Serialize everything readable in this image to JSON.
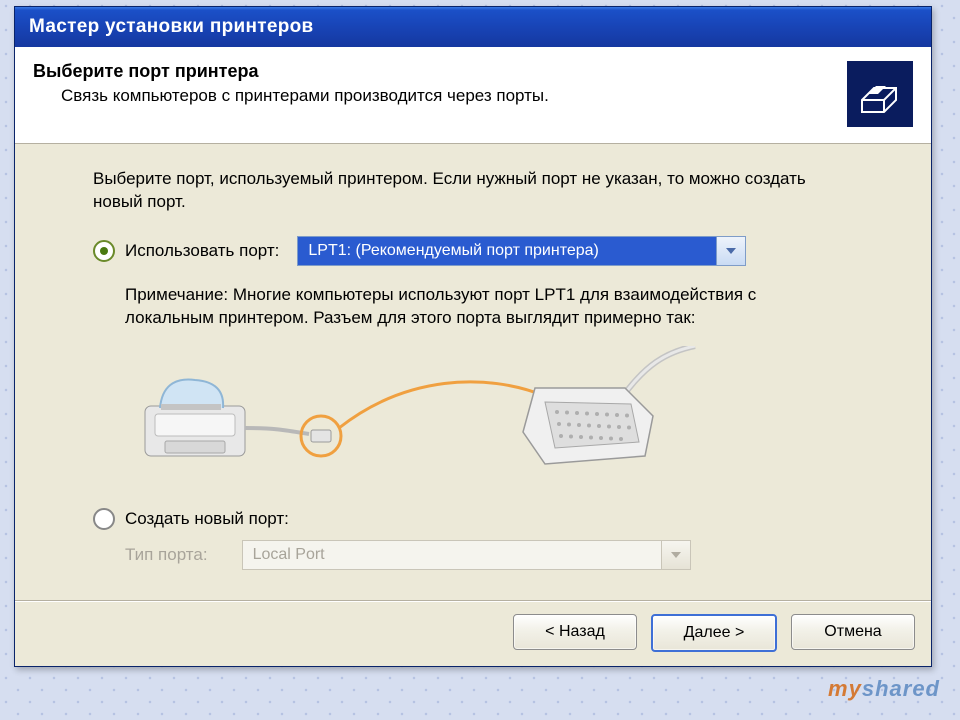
{
  "window": {
    "title": "Мастер установки принтеров"
  },
  "header": {
    "title": "Выберите порт принтера",
    "subtitle": "Связь компьютеров с принтерами производится через порты."
  },
  "body": {
    "instruction": "Выберите порт, используемый принтером. Если нужный порт не указан, то можно создать новый порт.",
    "use_port_label": "Использовать порт:",
    "use_port_value": "LPT1: (Рекомендуемый порт принтера)",
    "note": "Примечание: Многие компьютеры используют порт LPT1 для взаимодействия с локальным принтером. Разъем для этого порта выглядит примерно так:",
    "create_port_label": "Создать новый порт:",
    "port_type_label": "Тип порта:",
    "port_type_value": "Local Port"
  },
  "footer": {
    "back": "< Назад",
    "next": "Далее >",
    "cancel": "Отмена"
  },
  "watermark": {
    "part1": "my",
    "part2": "shared"
  }
}
